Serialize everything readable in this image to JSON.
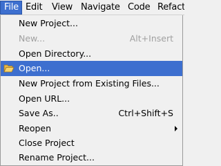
{
  "menubar": {
    "items": [
      {
        "label": "File"
      },
      {
        "label": "Edit"
      },
      {
        "label": "View"
      },
      {
        "label": "Navigate"
      },
      {
        "label": "Code"
      },
      {
        "label": "Refacto"
      }
    ]
  },
  "file_menu": {
    "items": [
      {
        "label": "New Project...",
        "accel": "",
        "enabled": true
      },
      {
        "label": "New...",
        "accel": "Alt+Insert",
        "enabled": false
      },
      {
        "label": "Open Directory...",
        "accel": "",
        "enabled": true
      },
      {
        "label": "Open...",
        "accel": "",
        "enabled": true,
        "highlighted": true,
        "icon": "folder-open-icon"
      },
      {
        "label": "New Project from Existing Files...",
        "accel": "",
        "enabled": true
      },
      {
        "label": "Open URL...",
        "accel": "",
        "enabled": true
      },
      {
        "label": "Save As..",
        "accel": "Ctrl+Shift+S",
        "enabled": true
      },
      {
        "label": "Reopen",
        "accel": "",
        "enabled": true,
        "submenu": true
      },
      {
        "label": "Close Project",
        "accel": "",
        "enabled": true
      },
      {
        "label": "Rename Project...",
        "accel": "",
        "enabled": true
      }
    ]
  },
  "colors": {
    "highlight": "#3d6fcf",
    "disabled_text": "#a0a0a0",
    "menu_bg": "#f0f0f0"
  }
}
